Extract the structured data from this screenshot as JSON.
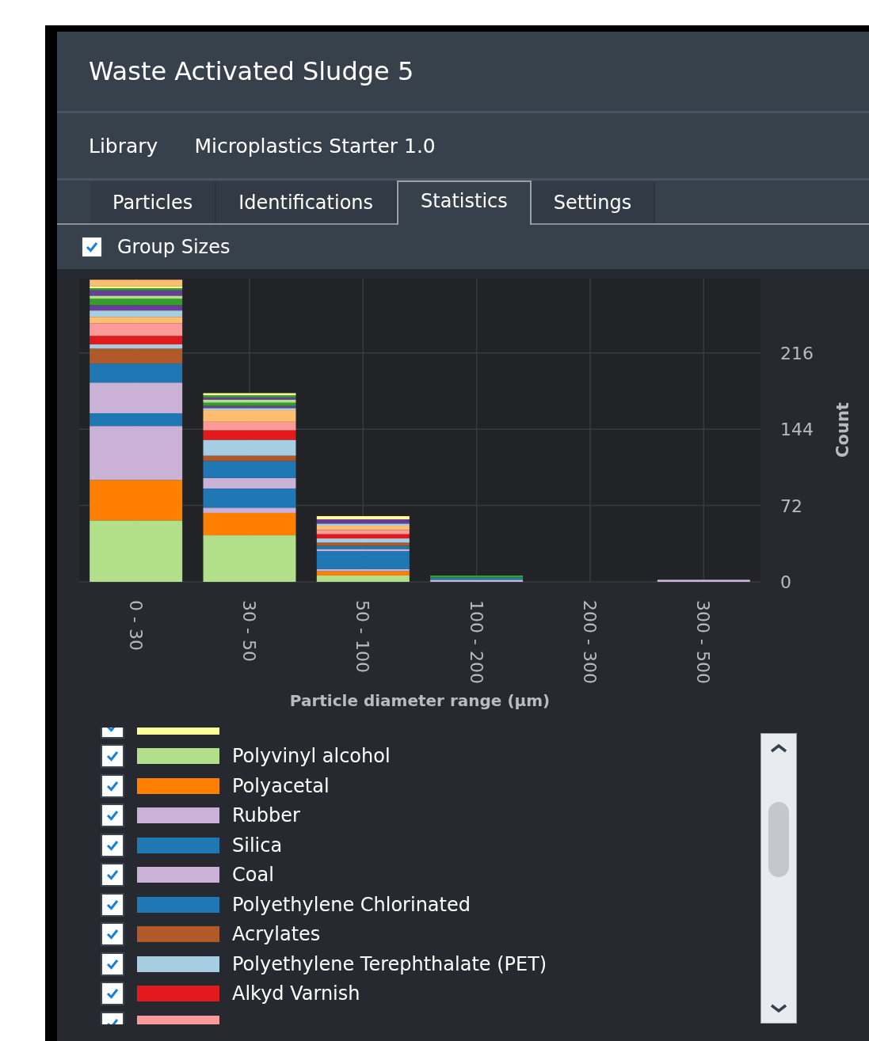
{
  "window": {
    "title": "Waste Activated Sludge 5"
  },
  "library": {
    "label": "Library",
    "value": "Microplastics Starter 1.0"
  },
  "tabs": [
    {
      "label": "Particles",
      "selected": false
    },
    {
      "label": "Identifications",
      "selected": false
    },
    {
      "label": "Statistics",
      "selected": true
    },
    {
      "label": "Settings",
      "selected": false
    }
  ],
  "group_sizes": {
    "label": "Group Sizes",
    "checked": true
  },
  "chart_data": {
    "type": "bar",
    "stacked": true,
    "grid": true,
    "xlabel": "Particle diameter range (µm)",
    "ylabel": "Count",
    "categories": [
      "0 - 30",
      "30 - 50",
      "50 - 100",
      "100 - 200",
      "200 - 300",
      "300 - 500"
    ],
    "ylim": [
      0,
      286
    ],
    "yticks": [
      0,
      72,
      144,
      216
    ],
    "series": [
      {
        "color": "#b2df8a",
        "values": [
          58,
          44,
          6,
          0,
          0,
          0
        ]
      },
      {
        "color": "#ff7f00",
        "values": [
          38,
          21,
          4,
          0,
          0,
          0
        ]
      },
      {
        "color": "#cab2d6",
        "values": [
          51,
          5,
          2,
          2,
          0,
          2
        ]
      },
      {
        "color": "#1f78b4",
        "values": [
          12,
          18,
          17,
          2,
          0,
          0
        ]
      },
      {
        "color": "#cab2d6",
        "values": [
          29,
          10,
          2,
          0,
          0,
          0
        ]
      },
      {
        "color": "#1f78b4",
        "values": [
          18,
          16,
          3,
          0,
          0,
          0
        ]
      },
      {
        "color": "#b15928",
        "values": [
          14,
          5,
          3,
          0,
          0,
          0
        ]
      },
      {
        "color": "#a6cee3",
        "values": [
          4,
          15,
          4,
          0,
          0,
          0
        ]
      },
      {
        "color": "#e31a1c",
        "values": [
          8,
          9,
          4,
          0,
          0,
          0
        ]
      },
      {
        "color": "#fb9a99",
        "values": [
          12,
          8,
          4,
          0,
          0,
          0
        ]
      },
      {
        "color": "#fdbf6f",
        "values": [
          6,
          11,
          4,
          0,
          0,
          0
        ]
      },
      {
        "color": "#a6cee3",
        "values": [
          6,
          2,
          2,
          0,
          0,
          0
        ]
      },
      {
        "color": "#6a3d9a",
        "values": [
          5,
          2,
          2,
          0,
          0,
          0
        ]
      },
      {
        "color": "#33a02c",
        "values": [
          6,
          3,
          0,
          2,
          0,
          0
        ]
      },
      {
        "color": "#b2df8a",
        "values": [
          3,
          3,
          0,
          0,
          0,
          0
        ]
      },
      {
        "color": "#6a3d9a",
        "values": [
          5,
          2,
          2,
          0,
          0,
          0
        ]
      },
      {
        "color": "#33a02c",
        "values": [
          2,
          2,
          0,
          0,
          0,
          0
        ]
      },
      {
        "color": "#ffff99",
        "values": [
          2,
          2,
          3,
          0,
          0,
          0
        ]
      },
      {
        "color": "#fdbf6f",
        "values": [
          6,
          0,
          0,
          0,
          0,
          0
        ]
      }
    ]
  },
  "legend": {
    "items": [
      {
        "kind": "clipped",
        "color": "#ffff99",
        "checked": true
      },
      {
        "kind": "item",
        "label": "Polyvinyl alcohol",
        "color": "#b2df8a",
        "checked": true
      },
      {
        "kind": "item",
        "label": "Polyacetal",
        "color": "#ff7f00",
        "checked": true
      },
      {
        "kind": "item",
        "label": "Rubber",
        "color": "#cab2d6",
        "checked": true
      },
      {
        "kind": "item",
        "label": "Silica",
        "color": "#1f78b4",
        "checked": true
      },
      {
        "kind": "item",
        "label": "Coal",
        "color": "#cab2d6",
        "checked": true
      },
      {
        "kind": "item",
        "label": "Polyethylene Chlorinated",
        "color": "#1f78b4",
        "checked": true
      },
      {
        "kind": "item",
        "label": "Acrylates",
        "color": "#b15928",
        "checked": true
      },
      {
        "kind": "item",
        "label": "Polyethylene Terephthalate (PET)",
        "color": "#a6cee3",
        "checked": true
      },
      {
        "kind": "item",
        "label": "Alkyd Varnish",
        "color": "#e31a1c",
        "checked": true
      },
      {
        "kind": "clipped",
        "color": "#fb9a99",
        "checked": true
      }
    ]
  }
}
